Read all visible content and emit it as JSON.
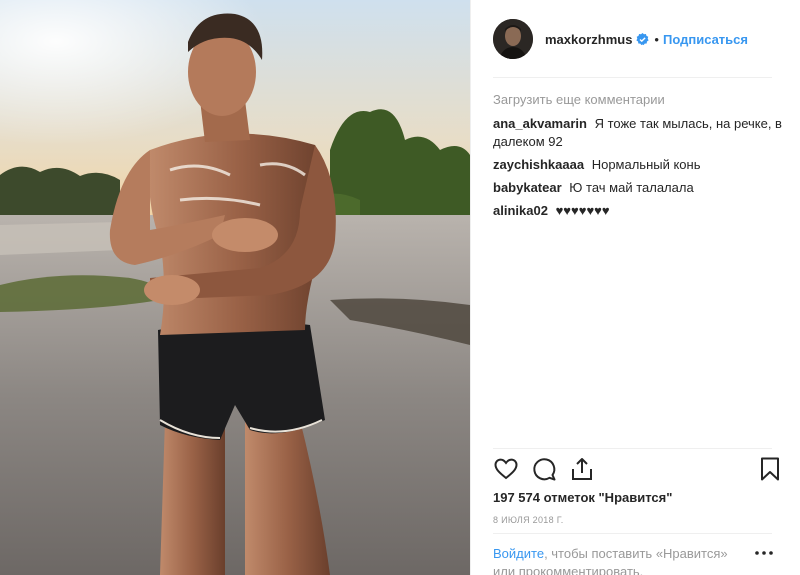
{
  "post": {
    "username": "maxkorzhmus",
    "separator": "•",
    "follow_label": "Подписаться",
    "load_more": "Загрузить еще комментарии",
    "comments": [
      {
        "author": "ana_akvamarin",
        "text": "Я тоже так мылась, на речке, в далеком 92"
      },
      {
        "author": "zaychishkaaaa",
        "text": "Нормальный конь"
      },
      {
        "author": "babykatear",
        "text": "Ю тач май талалала"
      },
      {
        "author": "alinika02",
        "text": "♥♥♥♥♥♥♥"
      }
    ],
    "likes": "197 574 отметок \"Нравится\"",
    "date": "8 ИЮЛЯ 2018 Г.",
    "login_link": "Войдите",
    "login_text": ", чтобы поставить «Нравится» или прокомментировать."
  },
  "colors": {
    "link": "#3897f0",
    "text": "#262626",
    "muted": "#999999",
    "verified": "#3897f0"
  },
  "icons": [
    "verified-icon",
    "heart-icon",
    "comment-icon",
    "share-icon",
    "bookmark-icon",
    "more-options-icon"
  ]
}
